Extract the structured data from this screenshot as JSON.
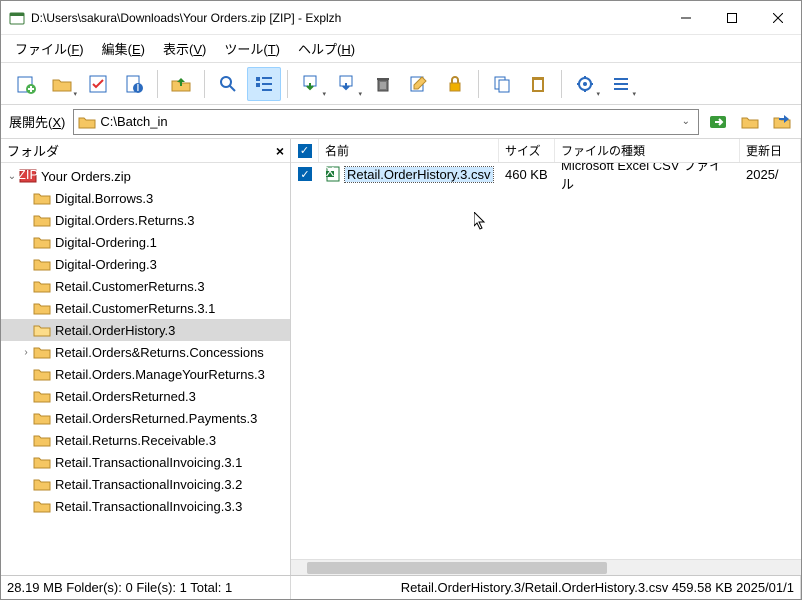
{
  "window": {
    "title": "D:\\Users\\sakura\\Downloads\\Your Orders.zip [ZIP] - Explzh"
  },
  "menu": {
    "file": "ファイル(<u>F</u>)",
    "edit": "編集(<u>E</u>)",
    "view": "表示(<u>V</u>)",
    "tool": "ツール(<u>T</u>)",
    "help": "ヘルプ(<u>H</u>)"
  },
  "pathbar": {
    "label": "展開先(<u>X</u>)",
    "value": "C:\\Batch_in"
  },
  "tree": {
    "header": "フォルダ",
    "root": "Your Orders.zip",
    "items": [
      "Digital.Borrows.3",
      "Digital.Orders.Returns.3",
      "Digital-Ordering.1",
      "Digital-Ordering.3",
      "Retail.CustomerReturns.3",
      "Retail.CustomerReturns.3.1",
      "Retail.OrderHistory.3",
      "Retail.Orders&Returns.Concessions",
      "Retail.Orders.ManageYourReturns.3",
      "Retail.OrdersReturned.3",
      "Retail.OrdersReturned.Payments.3",
      "Retail.Returns.Receivable.3",
      "Retail.TransactionalInvoicing.3.1",
      "Retail.TransactionalInvoicing.3.2",
      "Retail.TransactionalInvoicing.3.3"
    ],
    "selected_index": 6,
    "expandable_index": 7
  },
  "list": {
    "columns": {
      "name": "名前",
      "size": "サイズ",
      "type": "ファイルの種類",
      "mod": "更新日"
    },
    "rows": [
      {
        "name": "Retail.OrderHistory.3.csv",
        "size": "460 KB",
        "type": "Microsoft Excel CSV ファイル",
        "mod": "2025/",
        "checked": true,
        "selected": true
      }
    ]
  },
  "status": {
    "left": "28.19 MB  Folder(s): 0  File(s): 1  Total: 1",
    "right": "Retail.OrderHistory.3/Retail.OrderHistory.3.csv  459.58 KB  2025/01/1"
  }
}
